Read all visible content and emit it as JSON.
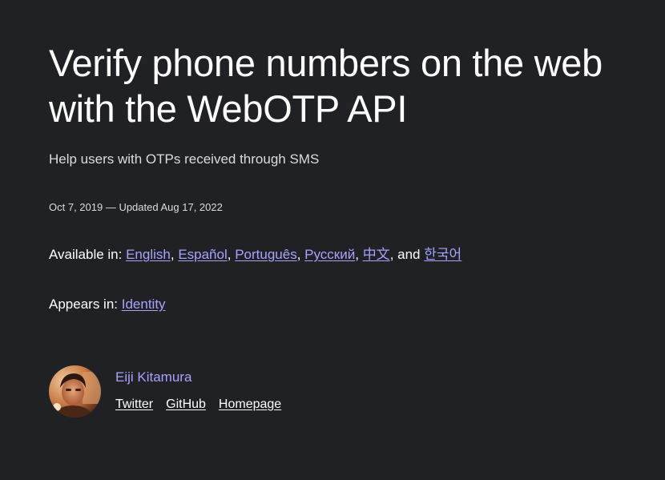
{
  "article": {
    "title": "Verify phone numbers on the web with the WebOTP API",
    "subtitle": "Help users with OTPs received through SMS",
    "published": "Oct 7, 2019",
    "date_separator": " — Updated ",
    "updated": "Aug 17, 2022"
  },
  "languages": {
    "prefix": "Available in: ",
    "items": [
      "English",
      "Español",
      "Português",
      "Русский",
      "中文",
      "한국어"
    ],
    "comma": ", ",
    "and": ", and "
  },
  "appears": {
    "prefix": "Appears in: ",
    "collection": "Identity"
  },
  "author": {
    "name": "Eiji Kitamura",
    "links": [
      "Twitter",
      "GitHub",
      "Homepage"
    ]
  },
  "colors": {
    "background": "#202124",
    "link": "#a8a2ff",
    "text": "#ffffff"
  }
}
